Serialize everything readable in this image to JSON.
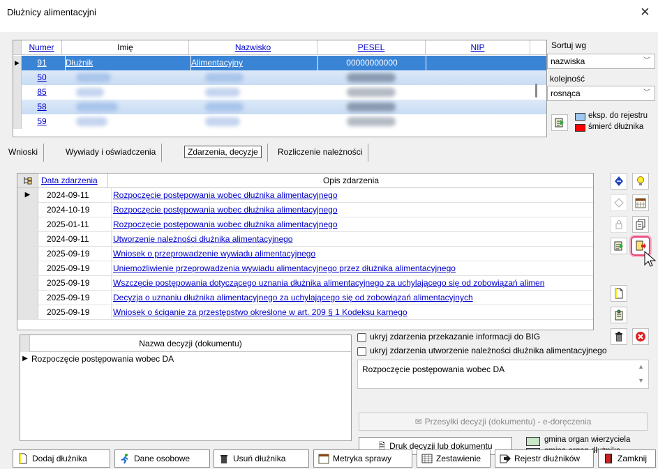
{
  "window": {
    "title": "Dłużnicy alimentacyjni",
    "close": "×"
  },
  "debtors": {
    "columns": [
      "Numer",
      "Imię",
      "Nazwisko",
      "PESEL",
      "NIP"
    ],
    "selected": {
      "numer": "91",
      "imie": "Dłużnik",
      "nazwisko": "Alimentacyjny",
      "pesel": "00000000000",
      "nip": ""
    },
    "other_numbers": [
      "50",
      "85",
      "58",
      "59"
    ]
  },
  "sort": {
    "label": "Sortuj wg",
    "by": "nazwiska",
    "order_label": "kolejność",
    "order": "rosnąca"
  },
  "legend_top": [
    {
      "label": "eksp. do rejestru",
      "color": "#9ec8f0"
    },
    {
      "label": "śmierć dłużnika",
      "color": "#ff0000"
    }
  ],
  "tabs": [
    "Wnioski",
    "Wywiady i oświadczenia",
    "Zdarzenia, decyzje",
    "Rozliczenie należności"
  ],
  "events": {
    "col_date": "Data zdarzenia",
    "col_desc": "Opis zdarzenia",
    "rows": [
      {
        "date": "2024-09-11",
        "desc": "Rozpoczęcie postępowania wobec dłużnika alimentacyjnego"
      },
      {
        "date": "2024-10-19",
        "desc": "Rozpoczęcie postępowania wobec dłużnika alimentacyjnego"
      },
      {
        "date": "2025-01-11",
        "desc": "Rozpoczęcie postępowania wobec dłużnika alimentacyjnego"
      },
      {
        "date": "2024-09-11",
        "desc": "Utworzenie należności dłużnika alimentacyjnego"
      },
      {
        "date": "2025-09-19",
        "desc": "Wniosek o przeprowadzenie wywiadu alimentacyjnego"
      },
      {
        "date": "2025-09-19",
        "desc": "Uniemożliwienie przeprowadzenia wywiadu alimentacyjnego przez dłużnika alimentacyjnego"
      },
      {
        "date": "2025-09-19",
        "desc": "Wszczęcie postępowania dotyczącego uznania dłużnika alimentacyjnego za uchylającego się od zobowiązań alimen"
      },
      {
        "date": "2025-09-19",
        "desc": "Decyzja o uznaniu dłużnika alimentacyjnego za uchylającego się od zobowiązań alimentacyjnych"
      },
      {
        "date": "2025-09-19",
        "desc": "Wniosek o ściganie za przestępstwo określone w art. 209 § 1 Kodeksu karnego"
      }
    ]
  },
  "decisions": {
    "col_name": "Nazwa decyzji (dokumentu)",
    "rows": [
      "Rozpoczęcie postępowania wobec DA"
    ]
  },
  "options": {
    "hide_big": "ukryj zdarzenia przekazanie informacji do BIG",
    "hide_receivable": "ukryj zdarzenia utworzenie należności dłużnika alimentacyjnego"
  },
  "description": "Rozpoczęcie postępowania wobec DA",
  "buttons": {
    "shipments": "Przesyłki decyzji (dokumentu) - e-doręczenia",
    "print": "Druk decyzji lub dokumentu"
  },
  "legend_bottom": [
    {
      "label": "gmina organ wierzyciela",
      "color": "#c8e6c8"
    },
    {
      "label": "gmina organ dłużnika",
      "color": "#b8d8f8"
    }
  ],
  "toolbar": {
    "add": "Dodaj dłużnika",
    "personal": "Dane osobowe",
    "delete": "Usuń dłużnika",
    "metrics": "Metryka sprawy",
    "summary": "Zestawienie",
    "registry": "Rejestr dłużników",
    "close": "Zamknij"
  },
  "colors": {
    "selection": "#3a84d6",
    "link": "#0000cc",
    "highlight": "#e5457a"
  }
}
